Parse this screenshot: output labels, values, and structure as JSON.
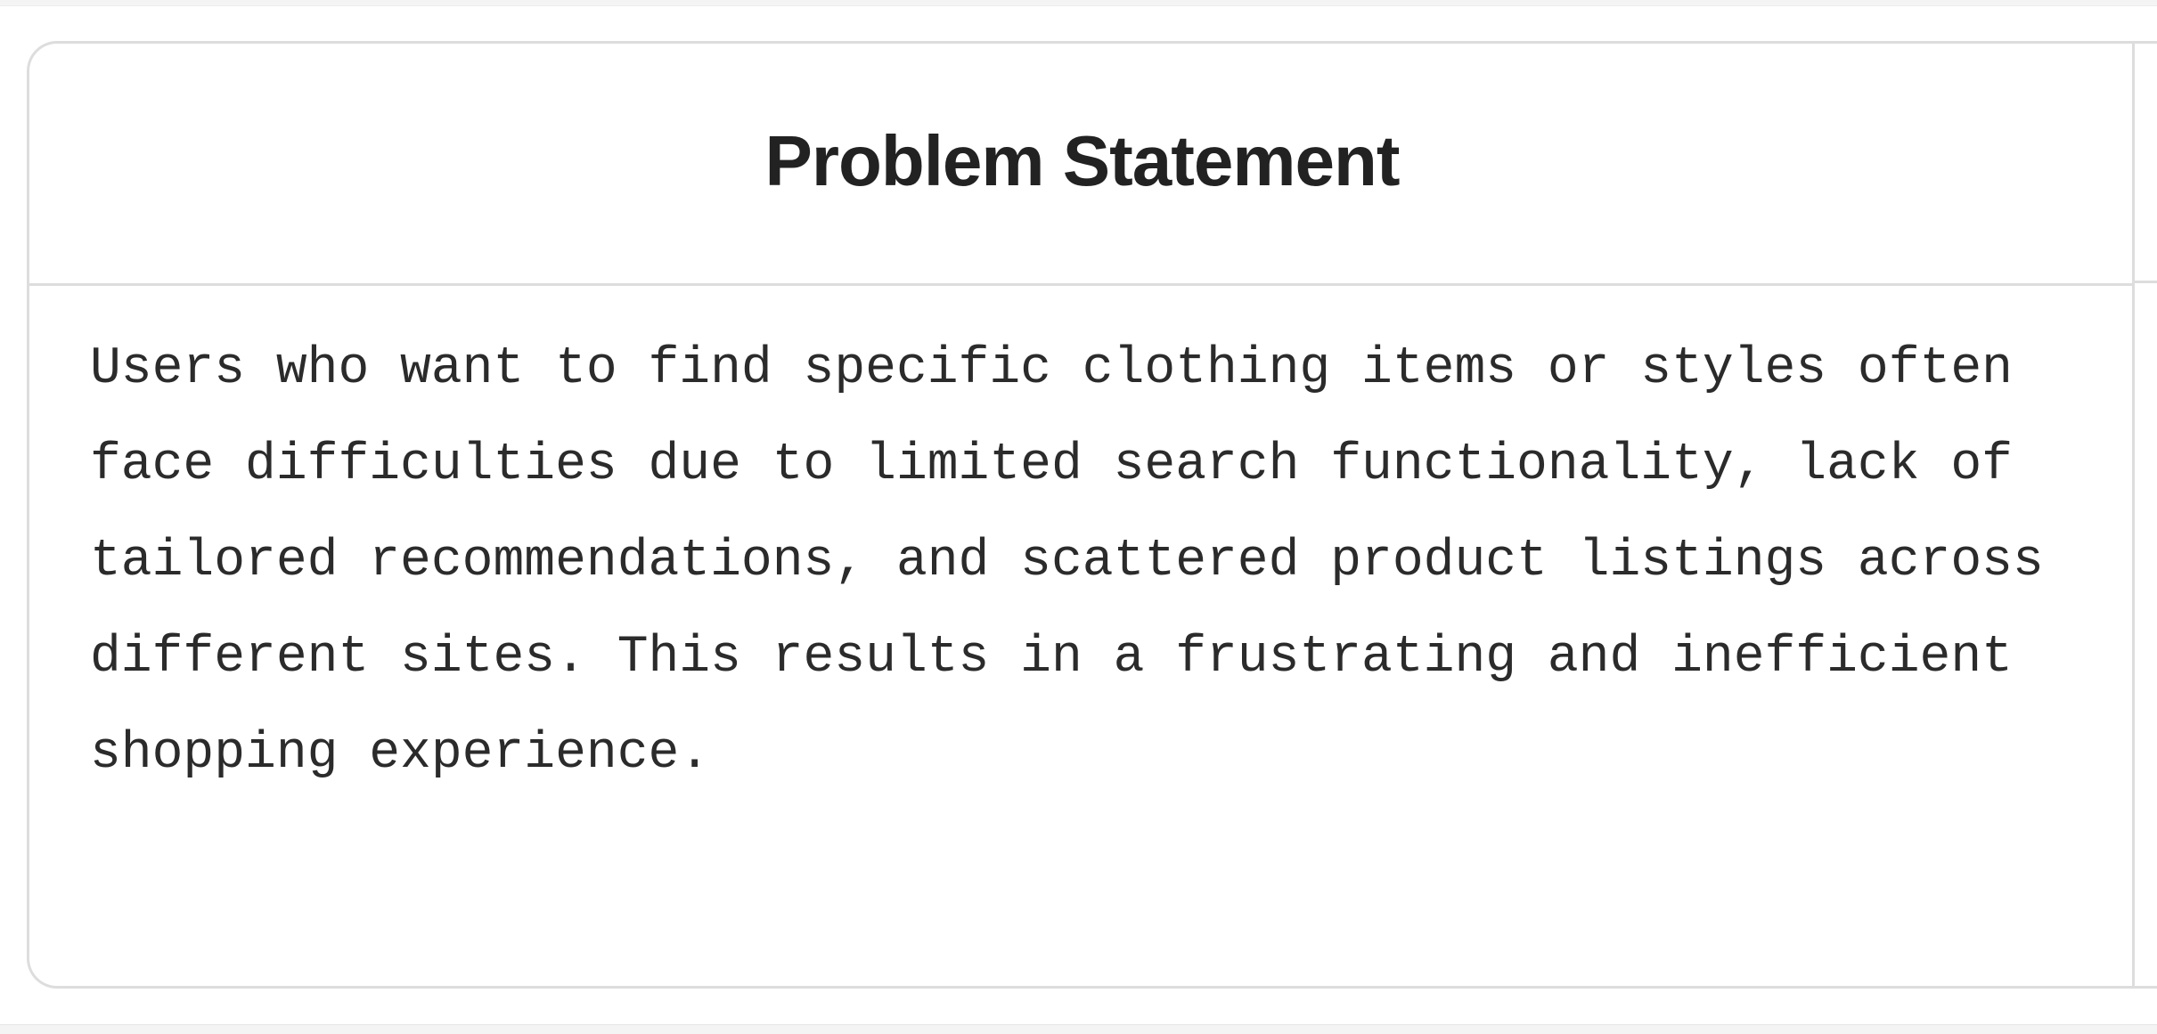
{
  "card": {
    "title": "Problem Statement",
    "body": "Users who want to find specific clothing items or styles often face difficulties due to limited search functionality, lack of tailored recommendations, and scattered product listings across different sites. This results in a frustrating and inefficient shopping experience."
  },
  "colors": {
    "border": "#dddddd",
    "title": "#222222",
    "text": "#2b2b2b",
    "background": "#ffffff"
  }
}
